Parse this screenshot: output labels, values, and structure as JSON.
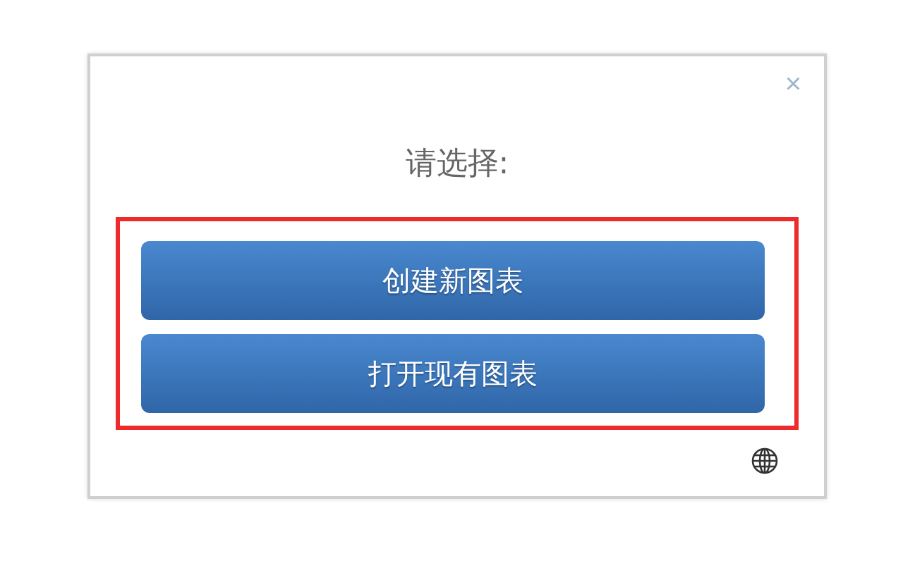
{
  "dialog": {
    "close": "×",
    "prompt": "请选择:",
    "buttons": [
      {
        "label": "创建新图表"
      },
      {
        "label": "打开现有图表"
      }
    ],
    "highlighted": true
  }
}
